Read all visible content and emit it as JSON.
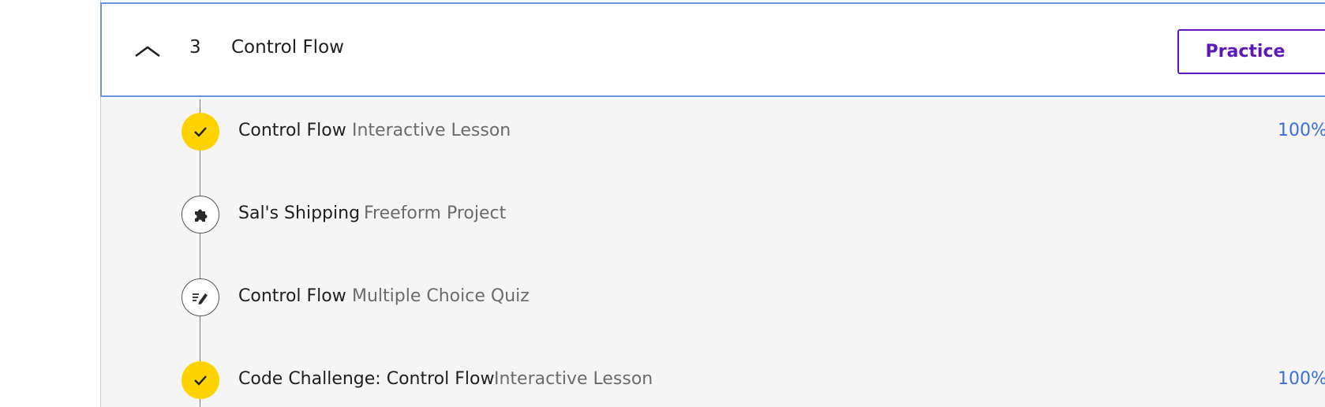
{
  "module": {
    "number": "3",
    "title": "Control Flow",
    "practice_label": "Practice",
    "collapse_icon": "chevron-up-icon"
  },
  "items": [
    {
      "title": "Control Flow",
      "type": "Interactive Lesson",
      "progress": "100%",
      "status": "complete",
      "icon": "check-icon"
    },
    {
      "title": "Sal's Shipping",
      "type": "Freeform Project",
      "progress": "",
      "status": "incomplete",
      "icon": "puzzle-icon"
    },
    {
      "title": "Control Flow",
      "type": "Multiple Choice Quiz",
      "progress": "",
      "status": "incomplete",
      "icon": "quiz-pencil-icon"
    },
    {
      "title": "Code Challenge: Control Flow",
      "type": "Interactive Lesson",
      "progress": "100%",
      "status": "complete",
      "icon": "check-icon"
    }
  ],
  "colors": {
    "complete": "#ffd300",
    "accent": "#5c18b8",
    "progress_text": "#3a6fd8",
    "header_border": "#6f95dd"
  }
}
